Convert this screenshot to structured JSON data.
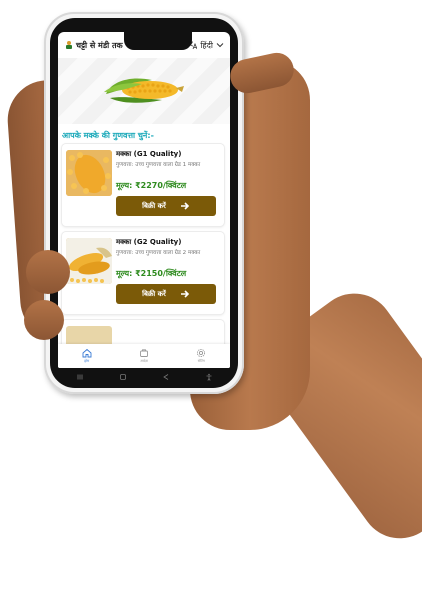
{
  "header": {
    "app_name": "चट्टी से मंडी तक",
    "language_label": "हिंदी"
  },
  "section_title": "आपके मक्के की गुणवत्ता चुनें:-",
  "products": [
    {
      "title": "मक्का (G1 Quality)",
      "description": "गुणवत्ता: उच्च गुणवत्ता वाला ग्रेड 1 मक्का",
      "price": "मूल्य: ₹2270/क्विंटल",
      "button_label": "बिक्री करें"
    },
    {
      "title": "मक्का (G2 Quality)",
      "description": "गुणवत्ता: उच्च गुणवत्ता वाला ग्रेड 2 मक्का",
      "price": "मूल्य: ₹2150/क्विंटल",
      "button_label": "बिक्री करें"
    }
  ],
  "bottom_nav": [
    {
      "label": "होम",
      "icon": "home-icon",
      "active": true
    },
    {
      "label": "आदेश",
      "icon": "orders-icon",
      "active": false
    },
    {
      "label": "सेटिंग",
      "icon": "settings-icon",
      "active": false
    }
  ],
  "colors": {
    "accent_button": "#7b5a08",
    "section_title": "#16a7b8",
    "price": "#2e8b1e",
    "nav_active": "#3a7bd5"
  }
}
